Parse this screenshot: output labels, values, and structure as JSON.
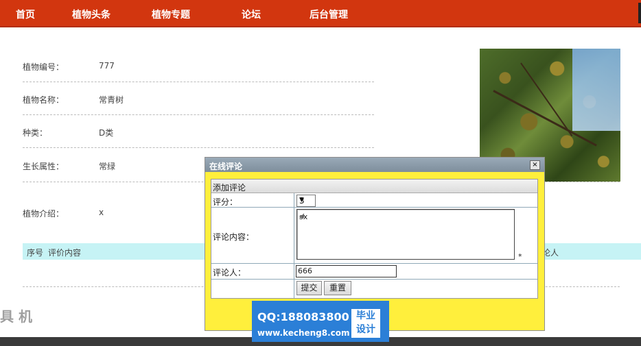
{
  "nav": {
    "items": [
      "首页",
      "植物头条",
      "植物专题",
      "论坛",
      "后台管理"
    ]
  },
  "detail": {
    "rows": [
      {
        "label": "植物编号：",
        "value": "777"
      },
      {
        "label": "植物名称：",
        "value": "常青树"
      },
      {
        "label": "种类：",
        "value": "D类"
      },
      {
        "label": "生长属性：",
        "value": "常绿"
      },
      {
        "label": "植物介绍：",
        "value": "x"
      }
    ]
  },
  "eval_table": {
    "col1": "序号",
    "col2": "评价内容",
    "col_right": "论人"
  },
  "dialog": {
    "title": "在线评论",
    "close": "×",
    "section": "添加评论",
    "score_label": "评分：",
    "score_value": "3",
    "content_label": "评论内容：",
    "content_value": "sx",
    "required_mark": "*",
    "reviewer_label": "评论人：",
    "reviewer_value": "666",
    "submit": "提交",
    "reset": "重置"
  },
  "banner": {
    "qq": "QQ:188083800",
    "site": "www.kecheng8.com",
    "badge_line1": "毕业",
    "badge_line2": "设计"
  },
  "watermark_left": "具 机"
}
